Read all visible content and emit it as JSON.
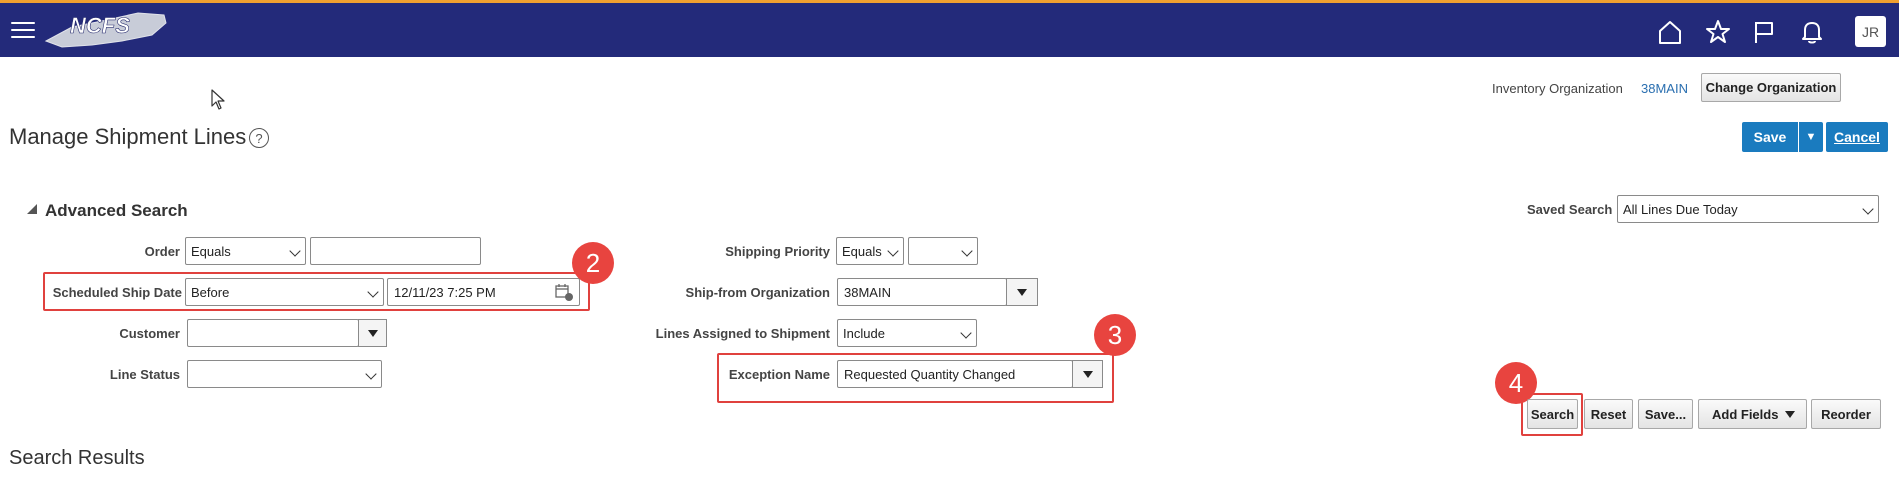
{
  "header": {
    "logo_text": "NCFS",
    "avatar_initials": "JR",
    "icons": [
      "home-icon",
      "star-icon",
      "flag-icon",
      "bell-icon"
    ],
    "colors": {
      "bar": "#232a7a",
      "accent_stripe": "#f0a030"
    }
  },
  "context": {
    "inventory_org_label": "Inventory Organization",
    "inventory_org_value": "38MAIN",
    "change_org_label": "Change Organization"
  },
  "page": {
    "title": "Manage Shipment Lines",
    "save_label": "Save",
    "cancel_label": "Cancel",
    "primary_color": "#1a7bbf"
  },
  "advanced_search": {
    "title": "Advanced Search",
    "saved_search_label": "Saved Search",
    "saved_search_value": "All Lines Due Today",
    "fields": {
      "order": {
        "label": "Order",
        "operator": "Equals",
        "value": ""
      },
      "scheduled_ship_date": {
        "label": "Scheduled Ship Date",
        "operator": "Before",
        "value": "12/11/23 7:25 PM"
      },
      "customer": {
        "label": "Customer",
        "value": ""
      },
      "line_status": {
        "label": "Line Status",
        "value": ""
      },
      "shipping_priority": {
        "label": "Shipping Priority",
        "operator": "Equals",
        "value": ""
      },
      "ship_from_org": {
        "label": "Ship-from Organization",
        "value": "38MAIN"
      },
      "lines_assigned": {
        "label": "Lines Assigned to Shipment",
        "value": "Include"
      },
      "exception_name": {
        "label": "Exception Name",
        "value": "Requested Quantity Changed"
      }
    },
    "buttons": {
      "search": "Search",
      "reset": "Reset",
      "save": "Save...",
      "add_fields": "Add Fields",
      "reorder": "Reorder"
    }
  },
  "annotations": {
    "step2": "2",
    "step3": "3",
    "step4": "4",
    "color": "#e0413e"
  },
  "results": {
    "title": "Search Results"
  }
}
